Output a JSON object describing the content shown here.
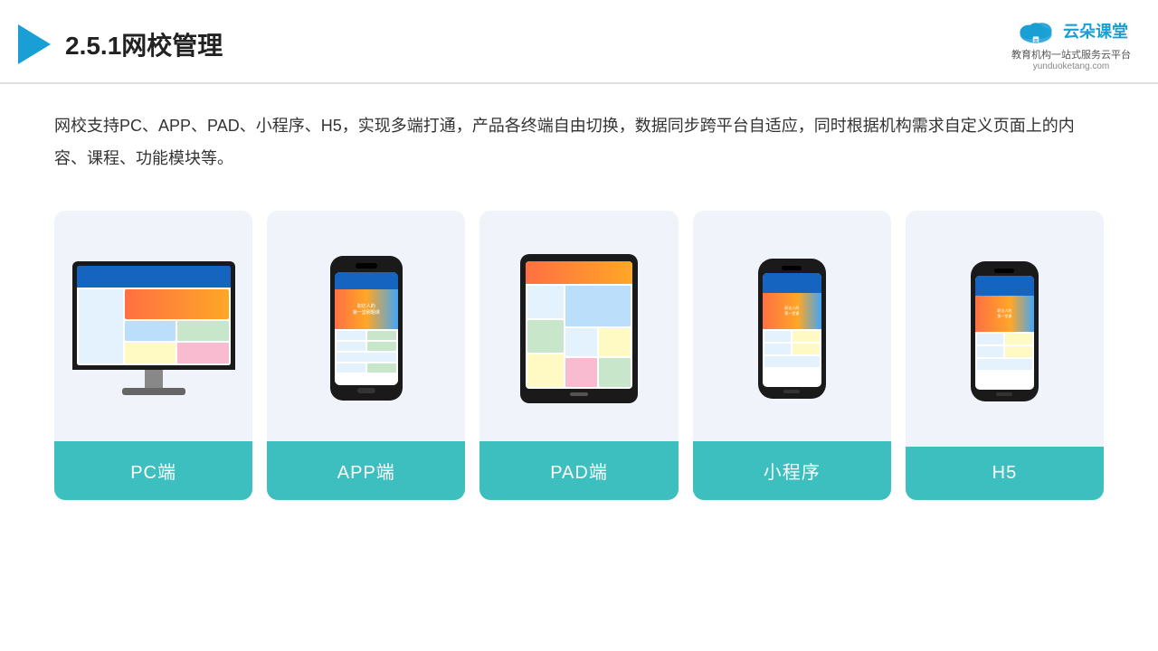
{
  "header": {
    "title": "2.5.1网校管理",
    "logo_text": "云朵课堂",
    "logo_url": "yunduoketang.com",
    "logo_tagline": "教育机构一站\n式服务云平台"
  },
  "description": {
    "text": "网校支持PC、APP、PAD、小程序、H5，实现多端打通，产品各终端自由切换，数据同步跨平台自适应，同时根据机构需求自定义页面上的内容、课程、功能模块等。"
  },
  "cards": [
    {
      "id": "pc",
      "label": "PC端"
    },
    {
      "id": "app",
      "label": "APP端"
    },
    {
      "id": "pad",
      "label": "PAD端"
    },
    {
      "id": "miniprogram",
      "label": "小程序"
    },
    {
      "id": "h5",
      "label": "H5"
    }
  ]
}
